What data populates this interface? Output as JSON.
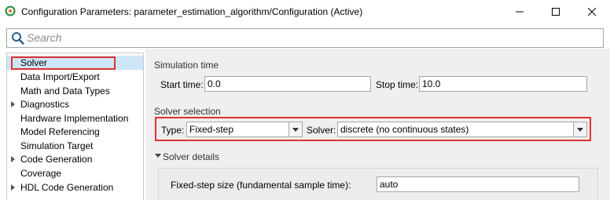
{
  "window": {
    "title": "Configuration Parameters: parameter_estimation_algorithm/Configuration (Active)",
    "app_icon": "simulink-gear-icon",
    "controls": [
      "minimize-icon",
      "maximize-icon",
      "close-icon"
    ]
  },
  "search": {
    "placeholder": "Search"
  },
  "tree": {
    "items": [
      {
        "label": "Solver",
        "selected": true,
        "expandable": false
      },
      {
        "label": "Data Import/Export",
        "selected": false,
        "expandable": false
      },
      {
        "label": "Math and Data Types",
        "selected": false,
        "expandable": false
      },
      {
        "label": "Diagnostics",
        "selected": false,
        "expandable": true
      },
      {
        "label": "Hardware Implementation",
        "selected": false,
        "expandable": false
      },
      {
        "label": "Model Referencing",
        "selected": false,
        "expandable": false
      },
      {
        "label": "Simulation Target",
        "selected": false,
        "expandable": false
      },
      {
        "label": "Code Generation",
        "selected": false,
        "expandable": true
      },
      {
        "label": "Coverage",
        "selected": false,
        "expandable": false
      },
      {
        "label": "HDL Code Generation",
        "selected": false,
        "expandable": true
      }
    ]
  },
  "simulation_time": {
    "section_label": "Simulation time",
    "start_label": "Start time:",
    "start_value": "0.0",
    "stop_label": "Stop time:",
    "stop_value": "10.0"
  },
  "solver_selection": {
    "section_label": "Solver selection",
    "type_label": "Type:",
    "type_value": "Fixed-step",
    "solver_label": "Solver:",
    "solver_value": "discrete (no continuous states)"
  },
  "solver_details": {
    "section_label": "Solver details",
    "step_size_label": "Fixed-step size (fundamental sample time):",
    "step_size_value": "auto"
  },
  "colors": {
    "highlight_red": "#e03131",
    "selection_blue": "#cde6f7",
    "pane_gray": "#efefef"
  }
}
